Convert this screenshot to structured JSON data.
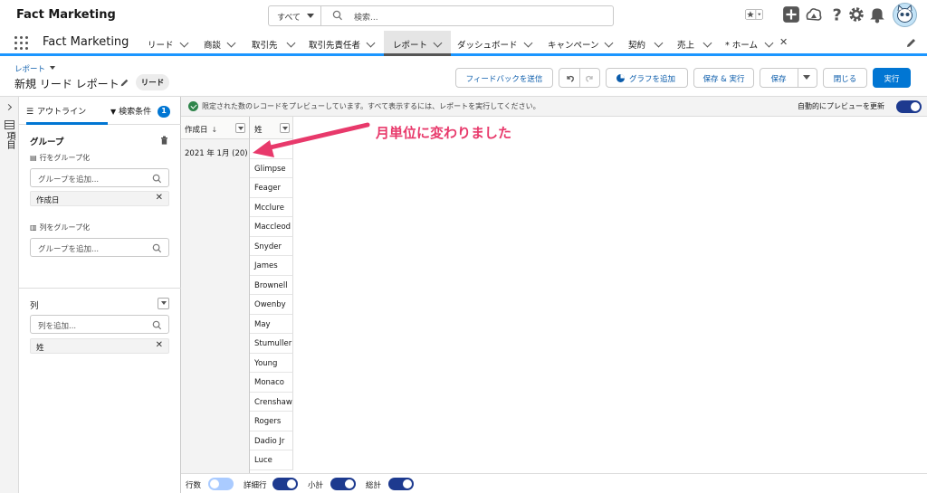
{
  "header": {
    "app_name": "Fact Marketing",
    "search_scope": "すべて",
    "search_placeholder": "検索..."
  },
  "nav": {
    "app_name": "Fact Marketing",
    "tabs": [
      "リード",
      "商談",
      "取引先",
      "取引先責任者",
      "レポート",
      "ダッシュボード",
      "キャンペーン",
      "契約",
      "売上",
      "* ホーム"
    ]
  },
  "report": {
    "breadcrumb": "レポート",
    "title": "新規 リード レポート",
    "type": "リード",
    "buttons": {
      "feedback": "フィードバックを送信",
      "add_chart": "グラフを追加",
      "save_run": "保存 & 実行",
      "save": "保存",
      "close": "閉じる",
      "run": "実行"
    }
  },
  "left_panel": {
    "strip_label": "項目",
    "tab_outline": "アウトライン",
    "tab_filters": "検索条件",
    "filter_count": "1",
    "groups_title": "グループ",
    "row_group_label": "行をグループ化",
    "row_group_placeholder": "グループを追加...",
    "row_group_value": "作成日",
    "col_group_label": "列をグループ化",
    "col_group_placeholder": "グループを追加...",
    "columns_title": "列",
    "columns_placeholder": "列を追加...",
    "column_value": "姓"
  },
  "preview": {
    "info": "限定された数のレコードをプレビューしています。すべて表示するには、レポートを実行してください。",
    "auto_preview": "自動的にプレビューを更新",
    "col1_header": "作成日",
    "col2_header": "姓",
    "group_label": "2021 年 1月 (20)",
    "rows": [
      "",
      "Glimpse",
      "Feager",
      "Mcclure",
      "Maccleod",
      "Snyder",
      "James",
      "Brownell",
      "Owenby",
      "May",
      "Stumuller",
      "Young",
      "Monaco",
      "Crenshaw",
      "Rogers",
      "Dadio Jr",
      "Luce"
    ],
    "annotation": "月単位に変わりました"
  },
  "footer": {
    "row_count": "行数",
    "detail_rows": "詳細行",
    "subtotal": "小計",
    "grand_total": "総計"
  },
  "colors": {
    "brand": "#0176d3",
    "annotation": "#e8396b",
    "toggle_on": "#1d3a8f"
  }
}
